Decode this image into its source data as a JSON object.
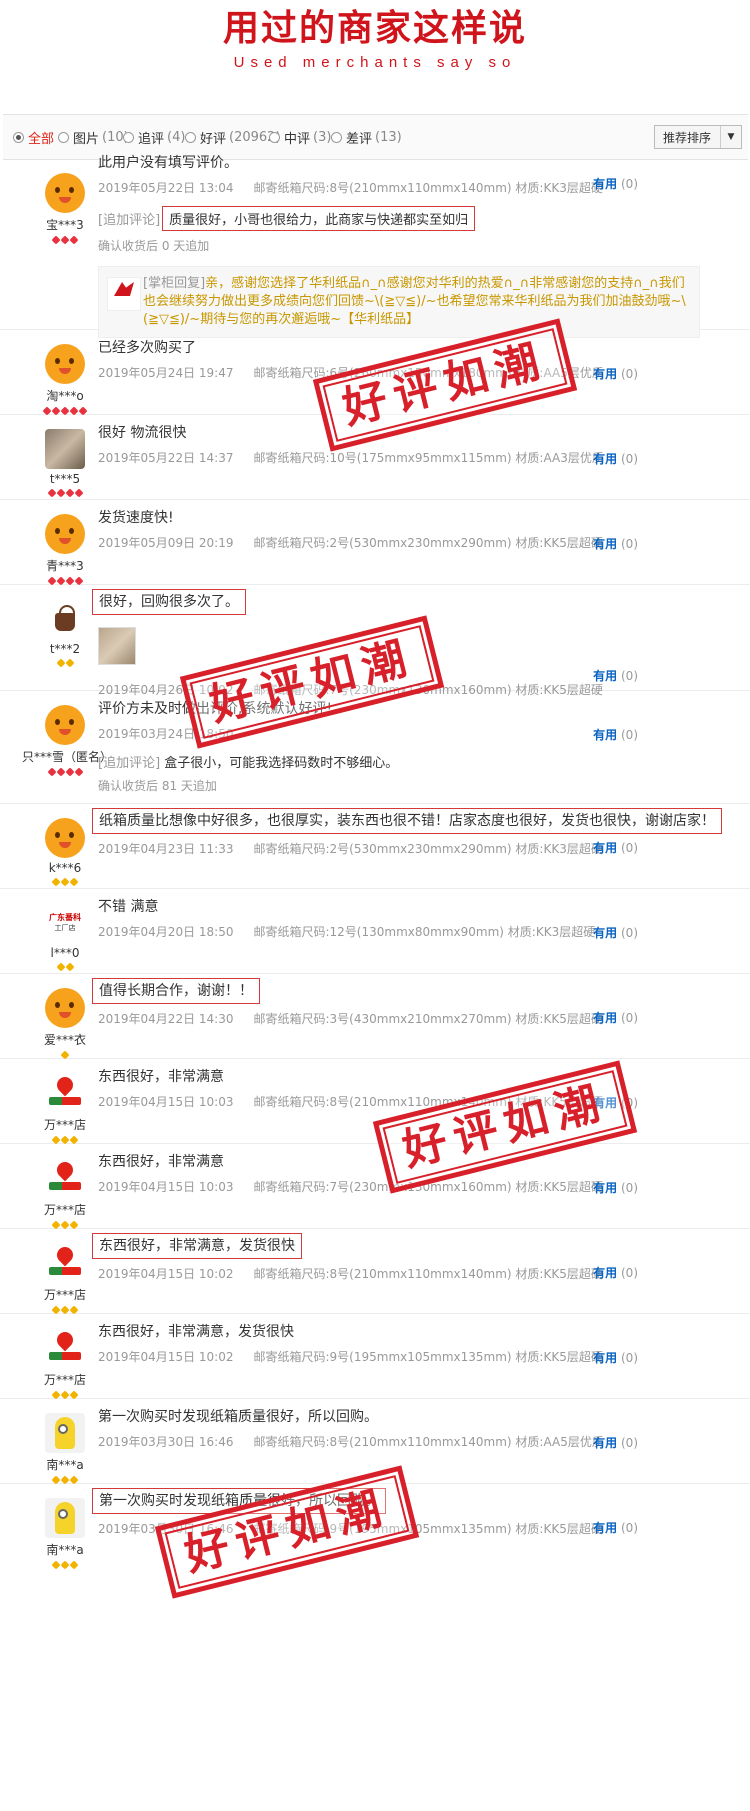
{
  "header": {
    "title": "用过的商家这样说",
    "subtitle": "Used merchants say so"
  },
  "filters": [
    {
      "label": "全部",
      "count": "",
      "selected": true
    },
    {
      "label": "图片",
      "count": "(10)"
    },
    {
      "label": "追评",
      "count": "(4)"
    },
    {
      "label": "好评",
      "count": "(20962)"
    },
    {
      "label": "中评",
      "count": "(3)"
    },
    {
      "label": "差评",
      "count": "(13)"
    }
  ],
  "sort": {
    "label": "推荐排序",
    "arrow": "▼"
  },
  "useful_label": "有用",
  "useful_count": "(0)",
  "spec_label": "邮寄纸箱尺码:",
  "material_label": "材质:",
  "stamp_text": "好评如潮",
  "reviews": [
    {
      "user": "宝***3",
      "text": "此用户没有填写评价。",
      "date": "2019年05月22日 13:04",
      "size": "8号(210mmx110mmx140mm)",
      "material": "KK3层超硬",
      "add_tag": "[追加评论]",
      "add_text": "质量很好，小哥也很给力，此商家与快递都实至如归",
      "add_note": "确认收货后 0 天追加",
      "reply_tag": "[掌柜回复]",
      "reply_text": "亲，感谢您选择了华利纸品∩_∩感谢您对华利的热爱∩_∩非常感谢您的支持∩_∩我们也会继续努力做出更多成绩向您们回馈~\\(≧▽≦)/~也希望您常来华利纸品为我们加油鼓劲哦~\\(≧▽≦)/~期待与您的再次邂逅哦~【华利纸品】"
    },
    {
      "user": "淘***o",
      "text": "已经多次购买了",
      "date": "2019年05月24日 19:47",
      "size": "6号(260mmx150mmx180mm)",
      "material": "AA5层优质"
    },
    {
      "user": "t***5",
      "text": "很好 物流很快",
      "date": "2019年05月22日 14:37",
      "size": "10号(175mmx95mmx115mm)",
      "material": "AA3层优质"
    },
    {
      "user": "青***3",
      "text": "发货速度快!",
      "date": "2019年05月09日 20:19",
      "size": "2号(530mmx230mmx290mm)",
      "material": "KK5层超硬"
    },
    {
      "user": "t***2",
      "text": "很好，回购很多次了。",
      "date": "2019年04月26日 10:02",
      "size": "7号(230mmx130mmx160mm)",
      "material": "KK5层超硬"
    },
    {
      "user": "只***雪（匿名）",
      "text": "评价方未及时做出评价,系统默认好评!",
      "date": "2019年03月24日 18:50",
      "add_tag": "[追加评论]",
      "add_text": "盒子很小，可能我选择码数时不够细心。",
      "add_note": "确认收货后 81 天追加"
    },
    {
      "user": "k***6",
      "text": "纸箱质量比想像中好很多，也很厚实，装东西也很不错！店家态度也很好，发货也很快，谢谢店家！",
      "date": "2019年04月23日 11:33",
      "size": "2号(530mmx230mmx290mm)",
      "material": "KK3层超硬"
    },
    {
      "user": "l***0",
      "text": "不错 满意",
      "date": "2019年04月20日 18:50",
      "size": "12号(130mmx80mmx90mm)",
      "material": "KK3层超硬",
      "avatar_text": "广东番科",
      "avatar_sub": "工厂店"
    },
    {
      "user": "爱***衣",
      "text": "值得长期合作，谢谢！！",
      "date": "2019年04月22日 14:30",
      "size": "3号(430mmx210mmx270mm)",
      "material": "KK5层超硬"
    },
    {
      "user": "万***店",
      "text": "东西很好，非常满意",
      "date": "2019年04月15日 10:03",
      "size": "8号(210mmx110mmx140mm)",
      "material": "KK5层超硬"
    },
    {
      "user": "万***店",
      "text": "东西很好，非常满意",
      "date": "2019年04月15日 10:03",
      "size": "7号(230mmx130mmx160mm)",
      "material": "KK5层超硬"
    },
    {
      "user": "万***店",
      "text": "东西很好，非常满意，发货很快",
      "date": "2019年04月15日 10:02",
      "size": "8号(210mmx110mmx140mm)",
      "material": "KK5层超硬"
    },
    {
      "user": "万***店",
      "text": "东西很好，非常满意，发货很快",
      "date": "2019年04月15日 10:02",
      "size": "9号(195mmx105mmx135mm)",
      "material": "KK5层超硬"
    },
    {
      "user": "南***a",
      "text": "第一次购买时发现纸箱质量很好，所以回购。",
      "date": "2019年03月30日 16:46",
      "size": "8号(210mmx110mmx140mm)",
      "material": "AA5层优质"
    },
    {
      "user": "南***a",
      "text": "第一次购买时发现纸箱质量很好，所以回购。",
      "date": "2019年03月30日 16:46",
      "size": "9号(195mmx105mmx135mm)",
      "material": "KK5层超硬"
    }
  ]
}
